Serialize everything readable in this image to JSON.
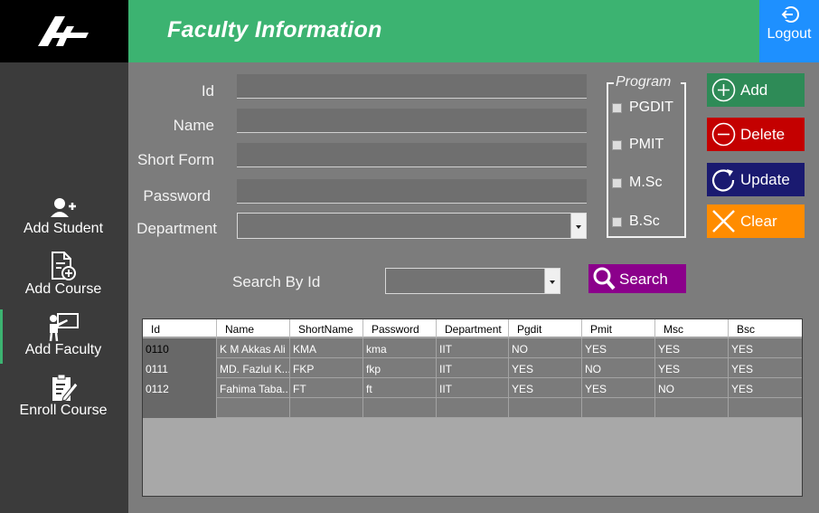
{
  "header": {
    "title": "Faculty Information",
    "logout_label": "Logout"
  },
  "sidebar": {
    "items": [
      {
        "label": "Add Student",
        "icon": "add-user-icon"
      },
      {
        "label": "Add Course",
        "icon": "add-document-icon"
      },
      {
        "label": "Add Faculty",
        "icon": "teacher-icon",
        "active": true
      },
      {
        "label": "Enroll Course",
        "icon": "clipboard-edit-icon"
      }
    ]
  },
  "form": {
    "id_label": "Id",
    "name_label": "Name",
    "short_form_label": "Short Form",
    "password_label": "Password",
    "department_label": "Department",
    "id_value": "",
    "name_value": "",
    "short_form_value": "",
    "password_value": "",
    "department_value": ""
  },
  "program": {
    "legend": "Program",
    "options": [
      "PGDIT",
      "PMIT",
      "M.Sc",
      "B.Sc"
    ]
  },
  "actions": {
    "add": "Add",
    "delete": "Delete",
    "update": "Update",
    "clear": "Clear"
  },
  "search": {
    "label": "Search By Id",
    "value": "",
    "button": "Search"
  },
  "grid": {
    "columns": [
      "Id",
      "Name",
      "ShortName",
      "Password",
      "Department",
      "Pgdit",
      "Pmit",
      "Msc",
      "Bsc"
    ],
    "rows": [
      [
        "0110",
        "K M Akkas Ali",
        "KMA",
        "kma",
        "IIT",
        "NO",
        "YES",
        "YES",
        "YES"
      ],
      [
        "0111",
        "MD. Fazlul K...",
        "FKP",
        "fkp",
        "IIT",
        "YES",
        "NO",
        "YES",
        "YES"
      ],
      [
        "0112",
        "Fahima Taba...",
        "FT",
        "ft",
        "IIT",
        "YES",
        "YES",
        "NO",
        "YES"
      ]
    ]
  },
  "colors": {
    "header_green": "#3cb371",
    "logout_blue": "#1e90ff",
    "add_green": "#2e8b57",
    "delete_red": "#c40000",
    "update_navy": "#1a1a70",
    "clear_orange": "#ff8c00",
    "search_purple": "#8b008b"
  }
}
